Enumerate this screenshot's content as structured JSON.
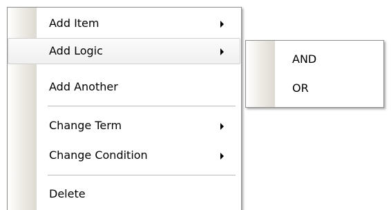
{
  "context_menu": {
    "items": [
      {
        "label": "Add Item",
        "has_submenu": true
      },
      {
        "label": "Add Logic",
        "has_submenu": true,
        "highlighted": true
      },
      {
        "label": "Add Another",
        "has_submenu": false
      },
      {
        "label": "Change Term",
        "has_submenu": true
      },
      {
        "label": "Change Condition",
        "has_submenu": true
      },
      {
        "label": "Delete",
        "has_submenu": false
      }
    ]
  },
  "submenu": {
    "parent": "Add Logic",
    "items": [
      {
        "label": "AND"
      },
      {
        "label": "OR"
      }
    ]
  },
  "colors": {
    "menu_border": "#8e8e8e",
    "gutter": "#dcdad2",
    "hover_border": "#cfcfcf",
    "separator": "#b9b9b9"
  }
}
